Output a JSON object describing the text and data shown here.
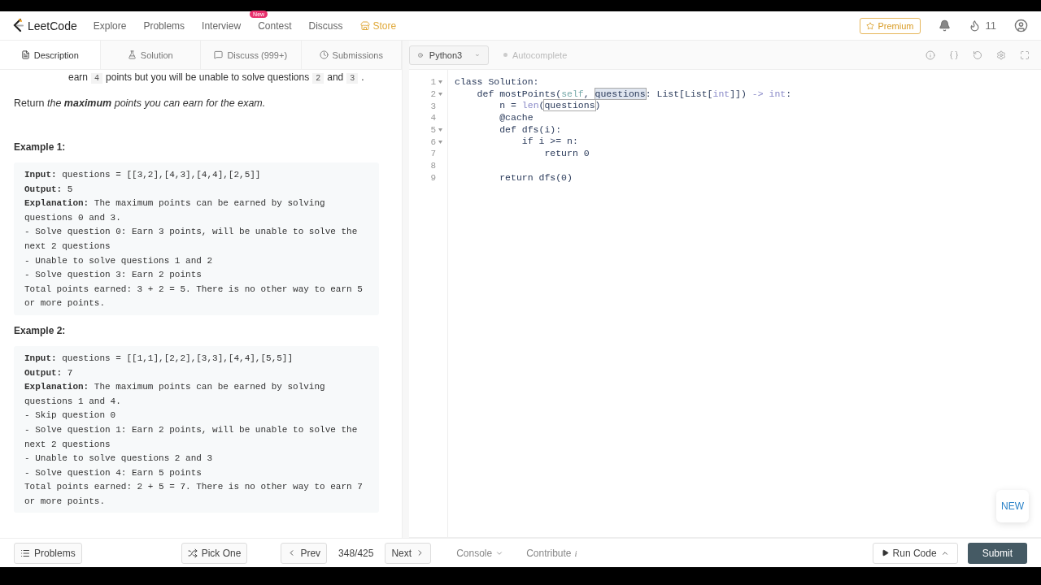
{
  "nav": {
    "logo": "LeetCode",
    "links": [
      {
        "label": "Explore"
      },
      {
        "label": "Problems"
      },
      {
        "label": "Interview",
        "badge": "New"
      },
      {
        "label": "Contest"
      },
      {
        "label": "Discuss"
      }
    ],
    "store": "Store",
    "premium": "Premium",
    "streak": "11"
  },
  "tabs": [
    {
      "label": "Description",
      "selected": true
    },
    {
      "label": "Solution",
      "selected": false
    },
    {
      "label": "Discuss (999+)",
      "selected": false
    },
    {
      "label": "Submissions",
      "selected": false
    }
  ],
  "description": {
    "intro": [
      {
        "kind": "text",
        "text": "earn"
      },
      {
        "kind": "code",
        "text": "4"
      },
      {
        "kind": "text",
        "text": "points but you will be unable to solve questions"
      },
      {
        "kind": "code",
        "text": "2"
      },
      {
        "kind": "text",
        "text": "and"
      },
      {
        "kind": "code",
        "text": "3"
      },
      {
        "kind": "text",
        "text": "."
      }
    ],
    "statement": [
      {
        "kind": "text",
        "text": "Return "
      },
      {
        "kind": "italic",
        "text": "the "
      },
      {
        "kind": "bold-italic",
        "text": "maximum"
      },
      {
        "kind": "italic",
        "text": " points you can earn for the exam."
      }
    ],
    "examples": [
      {
        "title": "Example 1:",
        "lines": [
          {
            "label": "Input:",
            "text": " questions = [[3,2],[4,3],[4,4],[2,5]]"
          },
          {
            "label": "Output:",
            "text": " 5"
          },
          {
            "label": "Explanation:",
            "text": " The maximum points can be earned by solving"
          },
          {
            "text": "questions 0 and 3."
          },
          {
            "text": "- Solve question 0: Earn 3 points, will be unable to solve the"
          },
          {
            "text": "next 2 questions"
          },
          {
            "text": "- Unable to solve questions 1 and 2"
          },
          {
            "text": "- Solve question 3: Earn 2 points"
          },
          {
            "text": "Total points earned: 3 + 2 = 5. There is no other way to earn 5"
          },
          {
            "text": "or more points."
          }
        ]
      },
      {
        "title": "Example 2:",
        "lines": [
          {
            "label": "Input:",
            "text": " questions = [[1,1],[2,2],[3,3],[4,4],[5,5]]"
          },
          {
            "label": "Output:",
            "text": " 7"
          },
          {
            "label": "Explanation:",
            "text": " The maximum points can be earned by solving"
          },
          {
            "text": "questions 1 and 4."
          },
          {
            "text": "- Skip question 0"
          },
          {
            "text": "- Solve question 1: Earn 2 points, will be unable to solve the"
          },
          {
            "text": "next 2 questions"
          },
          {
            "text": "- Unable to solve questions 2 and 3"
          },
          {
            "text": "- Solve question 4: Earn 5 points"
          },
          {
            "text": "Total points earned: 2 + 5 = 7. There is no other way to earn 7"
          },
          {
            "text": "or more points."
          }
        ]
      }
    ]
  },
  "editor": {
    "language": "Python3",
    "autocomplete": {
      "label": "Autocomplete",
      "on": false
    },
    "lines": [
      {
        "number": "1",
        "fold": true,
        "tokens": [
          {
            "kind": "plain",
            "text": "class Solution:"
          }
        ]
      },
      {
        "number": "2",
        "fold": true,
        "tokens": [
          {
            "kind": "plain",
            "text": "    def mostPoints("
          },
          {
            "kind": "self",
            "text": "self"
          },
          {
            "kind": "plain",
            "text": ", "
          },
          {
            "kind": "match",
            "text": "questions"
          },
          {
            "kind": "plain",
            "text": ": List[List["
          },
          {
            "kind": "builtin",
            "text": "int"
          },
          {
            "kind": "plain",
            "text": "]]) "
          },
          {
            "kind": "builtin",
            "text": "-> int"
          },
          {
            "kind": "plain",
            "text": ":"
          }
        ]
      },
      {
        "number": "3",
        "fold": false,
        "tokens": [
          {
            "kind": "plain",
            "text": "        n = "
          },
          {
            "kind": "builtin",
            "text": "len"
          },
          {
            "kind": "plain",
            "text": "("
          },
          {
            "kind": "bracket",
            "text": "questions"
          },
          {
            "kind": "plain",
            "text": ")"
          }
        ]
      },
      {
        "number": "4",
        "fold": false,
        "tokens": [
          {
            "kind": "plain",
            "text": "        @cache"
          }
        ]
      },
      {
        "number": "5",
        "fold": true,
        "tokens": [
          {
            "kind": "plain",
            "text": "        def dfs(i):"
          }
        ]
      },
      {
        "number": "6",
        "fold": true,
        "tokens": [
          {
            "kind": "plain",
            "text": "            if i >= n:"
          }
        ]
      },
      {
        "number": "7",
        "fold": false,
        "tokens": [
          {
            "kind": "plain",
            "text": "                return 0"
          }
        ]
      },
      {
        "number": "8",
        "fold": false
      },
      {
        "number": "9",
        "fold": false,
        "tokens": [
          {
            "kind": "plain",
            "text": "        return dfs(0)"
          }
        ]
      }
    ],
    "new_button": "NEW"
  },
  "footer": {
    "problems": "Problems",
    "pick_one": "Pick One",
    "prev": "Prev",
    "counter": "348/425",
    "next": "Next",
    "console": "Console",
    "contribute": "Contribute",
    "contribute_mark": "i",
    "run": "Run Code",
    "submit": "Submit"
  }
}
